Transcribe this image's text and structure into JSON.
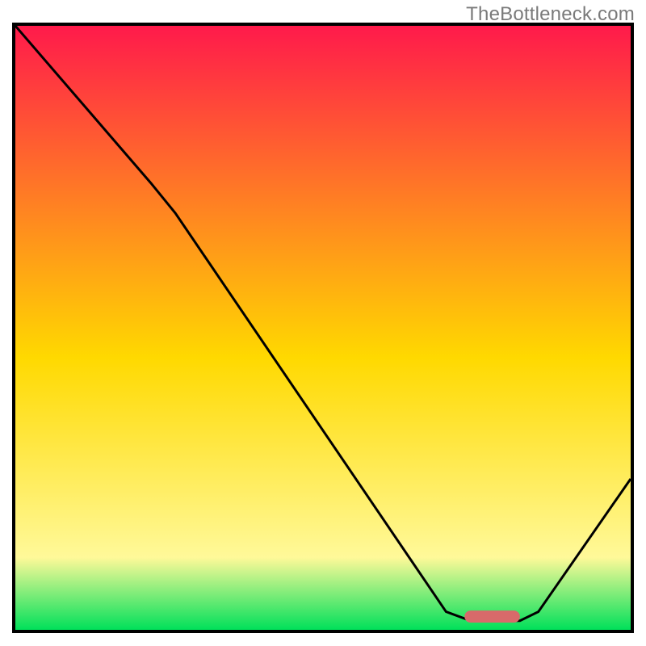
{
  "branding": {
    "watermark": "TheBottleneck.com"
  },
  "chart_data": {
    "type": "line",
    "title": "",
    "xlabel": "",
    "ylabel": "",
    "ylim": [
      0,
      100
    ],
    "xlim": [
      0,
      100
    ],
    "background_gradient": {
      "top_color": "#ff1a4b",
      "mid_color": "#ffd900",
      "lower_color": "#fff999",
      "bottom_color": "#00e05a"
    },
    "curve": {
      "name": "bottleneck-curve",
      "points": [
        {
          "x": 0,
          "y": 100
        },
        {
          "x": 22,
          "y": 74
        },
        {
          "x": 26,
          "y": 69
        },
        {
          "x": 70,
          "y": 3
        },
        {
          "x": 74,
          "y": 1.5
        },
        {
          "x": 82,
          "y": 1.5
        },
        {
          "x": 85,
          "y": 3
        },
        {
          "x": 100,
          "y": 25
        }
      ]
    },
    "optimal_marker": {
      "color": "#d86a6a",
      "x_start": 73,
      "x_end": 82,
      "y": 2.2,
      "thickness": 2.0
    }
  }
}
